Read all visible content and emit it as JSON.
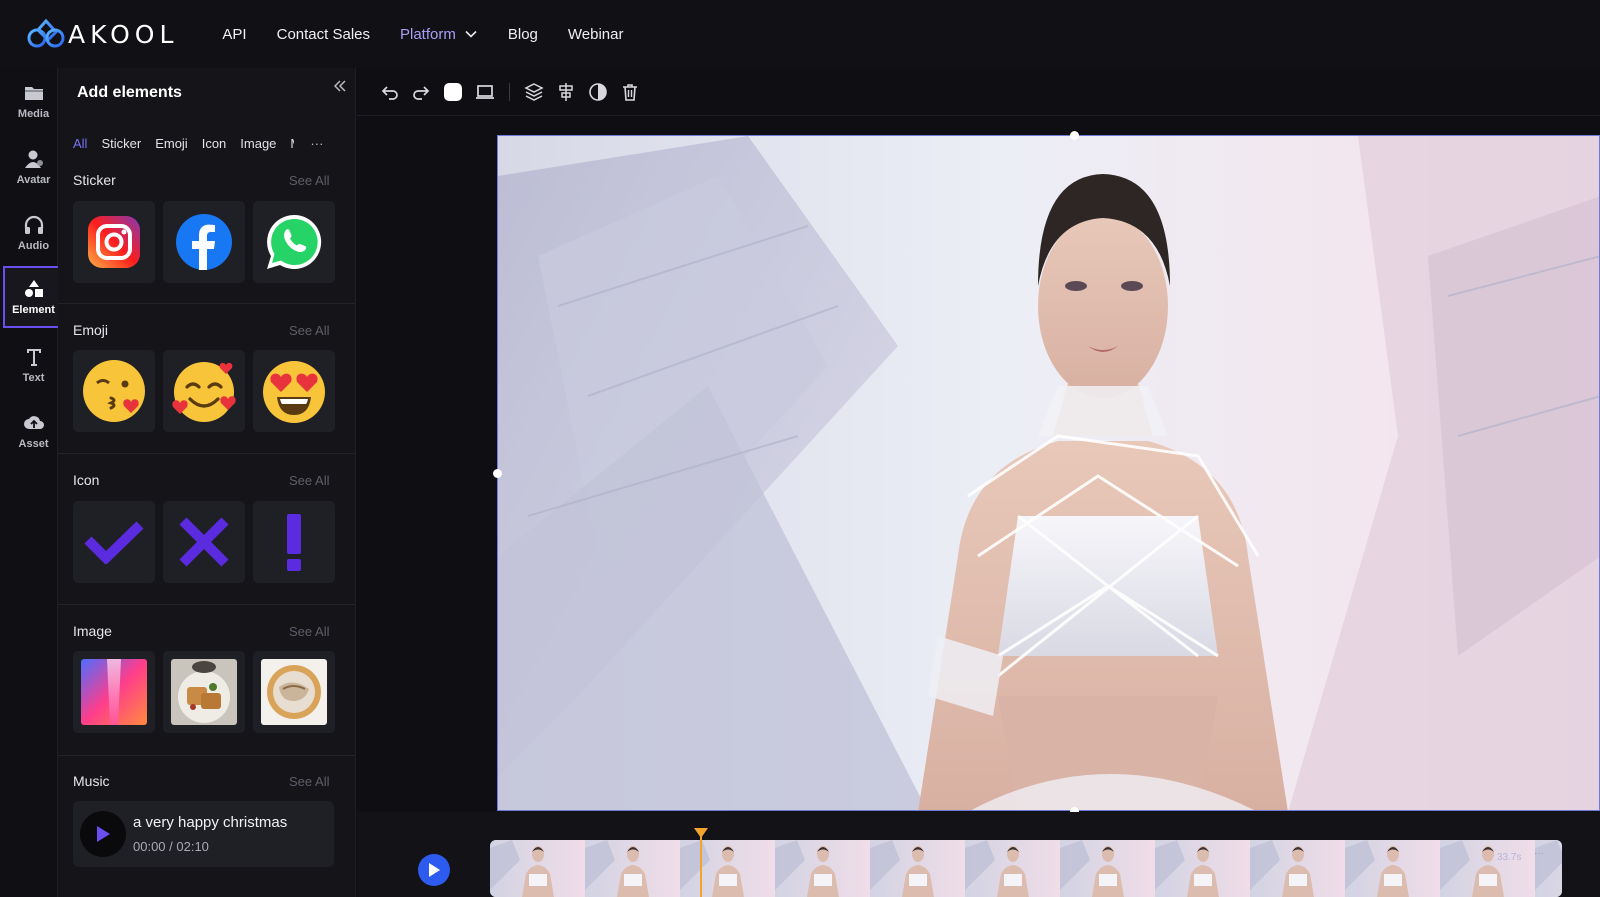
{
  "brand": {
    "logo_text": "AKOOL",
    "accent": "#6a4ef0"
  },
  "topnav": {
    "links": [
      {
        "label": "API"
      },
      {
        "label": "Contact Sales"
      },
      {
        "label": "Platform",
        "accent": true
      },
      {
        "label": "Blog"
      },
      {
        "label": "Webinar"
      }
    ]
  },
  "rail": {
    "items": [
      {
        "label": "Media",
        "icon": "folder-icon"
      },
      {
        "label": "Avatar",
        "icon": "avatar-icon"
      },
      {
        "label": "Audio",
        "icon": "headphones-icon"
      },
      {
        "label": "Element",
        "icon": "shapes-icon",
        "active": true
      },
      {
        "label": "Text",
        "icon": "text-icon"
      },
      {
        "label": "Asset",
        "icon": "cloud-upload-icon"
      }
    ]
  },
  "panel": {
    "title": "Add elements",
    "tabs": [
      "All",
      "Sticker",
      "Emoji",
      "Icon",
      "Image",
      "Music"
    ],
    "more": "···",
    "see_all": "See All",
    "sections": {
      "sticker": {
        "title": "Sticker",
        "items": [
          "instagram-icon",
          "facebook-icon",
          "whatsapp-icon"
        ]
      },
      "emoji": {
        "title": "Emoji",
        "items": [
          "kissing-face-emoji",
          "smiling-face-with-hearts-emoji",
          "heart-eyes-emoji"
        ]
      },
      "icon": {
        "title": "Icon",
        "items": [
          "check-icon",
          "x-icon",
          "exclamation-icon"
        ]
      },
      "image": {
        "title": "Image",
        "items": [
          "gradient-corridor-image",
          "waffles-plate-image",
          "food-bowl-image"
        ]
      },
      "music": {
        "title": "Music",
        "track": "a very happy christmas",
        "time": "00:00 / 02:10"
      }
    }
  },
  "toolbar": {
    "tools": [
      "undo-icon",
      "redo-icon",
      "background-color-icon",
      "screen-icon",
      "layers-icon",
      "align-icon",
      "contrast-icon",
      "trash-icon"
    ]
  },
  "timeline": {
    "duration": "33.7s",
    "menu": "···"
  }
}
